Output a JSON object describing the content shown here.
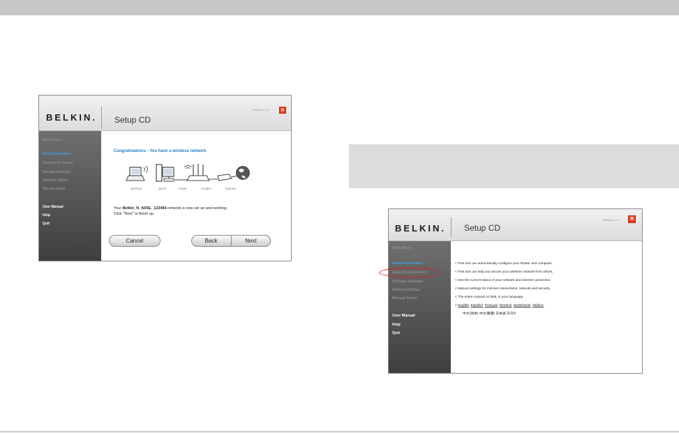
{
  "colors": {
    "accent": "#3aa3e6",
    "close": "#e8441d",
    "highlight_oval": "#d2232a"
  },
  "window1": {
    "logo": "BELKIN.",
    "title": "Setup CD",
    "version": "Version 1.1.0",
    "close_icon": "close-icon",
    "menu": {
      "main_menu": "Main Menu",
      "items": [
        "Setup Assistant  >",
        "Security Assistant",
        "Storage Manager",
        "Network Status",
        "Manual Setup"
      ],
      "footer": [
        "User Manual",
        "Help",
        "Quit"
      ]
    },
    "heading": "Congratulations - You have a wireless network",
    "devices": [
      "wireless",
      "wired",
      "router",
      "modem",
      "internet"
    ],
    "status_prefix": "Your ",
    "network_name": "Belkin_N_ADSL_123456",
    "status_suffix": " network is now set up and working.",
    "status_line2": "Click \"Next\" to finish up.",
    "buttons": {
      "cancel": "Cancel",
      "back": "Back",
      "next": "Next"
    }
  },
  "window2": {
    "logo": "BELKIN.",
    "title": "Setup CD",
    "version": "Version 1.1.0",
    "close_icon": "close-icon",
    "menu": {
      "main_menu": "Main Menu",
      "items": [
        "Setup Assistant  >",
        "Security Assistant",
        "Storage Manager",
        "Network Status",
        "Manual Setup"
      ],
      "footer": [
        "User Manual",
        "Help",
        "Quit"
      ]
    },
    "descriptions": [
      "<  This tool can automatically configure your Router and computer.",
      "<  This tool can help you secure your wireless network from others.",
      "<  See the current status of your network and internet connection.",
      "<  Manual settings for Internet connections, network and security.",
      "<  The entire manual on disk, in your language."
    ],
    "languages_prefix": "<  ",
    "languages": [
      "English",
      "Español",
      "Français",
      "Deutsch",
      "Nederlands",
      "Italiano"
    ],
    "languages_line2": "中文(简体)  中文(繁體)  日本語  한국어"
  }
}
